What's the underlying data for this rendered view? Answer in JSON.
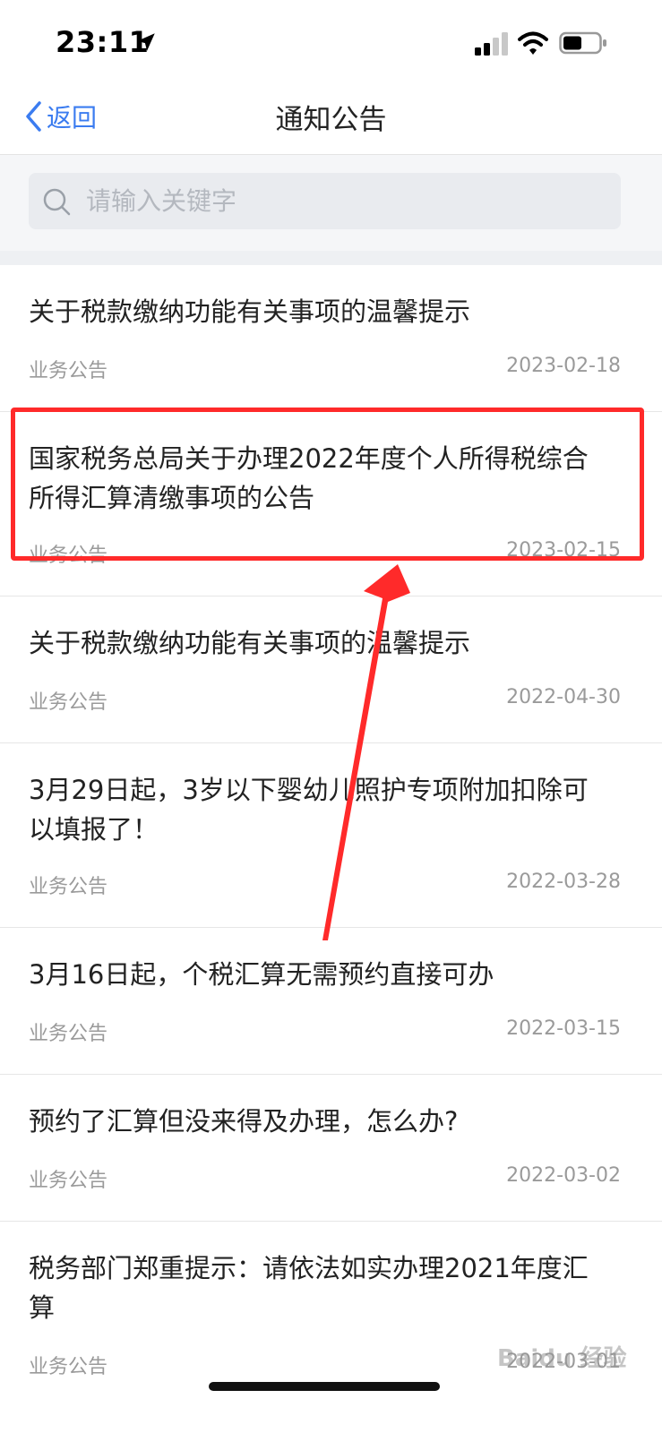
{
  "status_bar": {
    "time": "23:11"
  },
  "nav": {
    "back_label": "返回",
    "title": "通知公告"
  },
  "search": {
    "placeholder": "请输入关键字",
    "value": ""
  },
  "notices": [
    {
      "title": "关于税款缴纳功能有关事项的温馨提示",
      "category": "业务公告",
      "date": "2023-02-18"
    },
    {
      "title": "国家税务总局关于办理2022年度个人所得税综合所得汇算清缴事项的公告",
      "category": "业务公告",
      "date": "2023-02-15"
    },
    {
      "title": "关于税款缴纳功能有关事项的温馨提示",
      "category": "业务公告",
      "date": "2022-04-30"
    },
    {
      "title": "3月29日起，3岁以下婴幼儿照护专项附加扣除可以填报了！",
      "category": "业务公告",
      "date": "2022-03-28"
    },
    {
      "title": "3月16日起，个税汇算无需预约直接可办",
      "category": "业务公告",
      "date": "2022-03-15"
    },
    {
      "title": "预约了汇算但没来得及办理，怎么办?",
      "category": "业务公告",
      "date": "2022-03-02"
    },
    {
      "title": "税务部门郑重提示：请依法如实办理2021年度汇算",
      "category": "业务公告",
      "date": "2022-03-01"
    }
  ],
  "watermark": "Baidu 经验",
  "colors": {
    "accent": "#3b7cf0",
    "annotation": "#ff2a2a"
  }
}
